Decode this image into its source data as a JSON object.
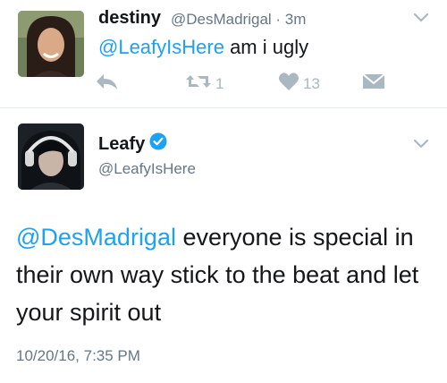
{
  "tweet1": {
    "name": "destiny",
    "handle": "@DesMadrigal",
    "age": "· 3m",
    "mention": "@LeafyIsHere",
    "text": " am i ugly",
    "retweets": "1",
    "likes": "13"
  },
  "tweet2": {
    "name": "Leafy",
    "handle": "@LeafyIsHere",
    "mention": "@DesMadrigal",
    "text": " everyone is special in their own way stick to the beat and let your spirit out",
    "timestamp": "10/20/16, 7:35 PM"
  },
  "icons": {
    "reply": "reply-icon",
    "retweet": "retweet-icon",
    "like": "heart-icon",
    "dm": "envelope-icon",
    "caret": "chevron-down-icon",
    "verified": "verified-badge-icon"
  },
  "colors": {
    "link": "#1da1f2",
    "secondary_text": "#657786",
    "action_gray": "#aab8c2",
    "divider": "#e1e8ed"
  }
}
